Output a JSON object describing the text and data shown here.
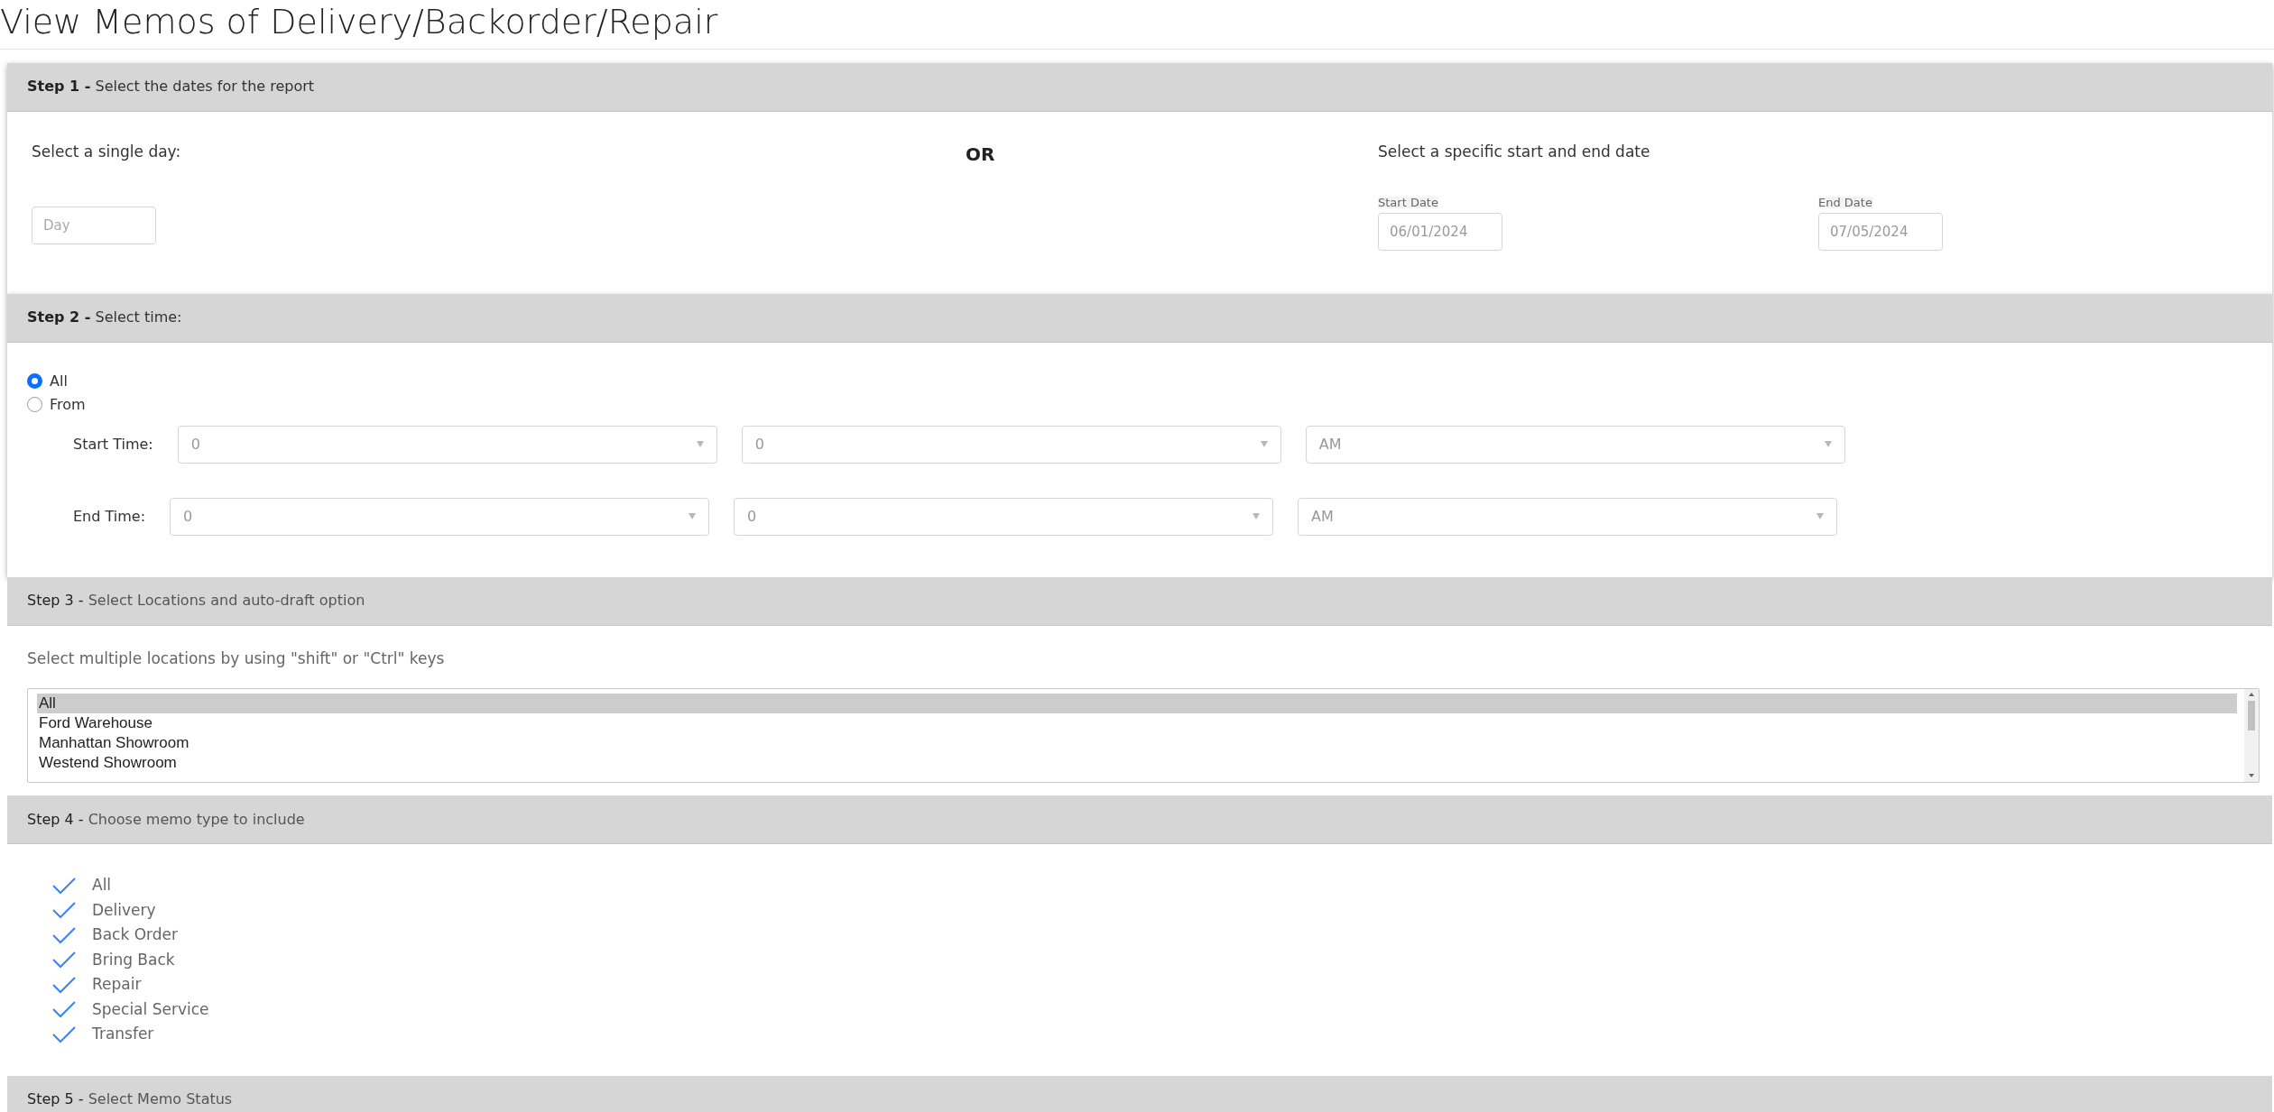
{
  "title": "View Memos of Delivery/Backorder/Repair",
  "steps": [
    {
      "kind": "dates",
      "label": "Step 1 -",
      "text": "Select the dates for the report",
      "active": true,
      "single_day": {
        "label": "Select a single day:",
        "placeholder": "Day"
      },
      "separator": "OR",
      "range": {
        "label": "Select a specific start and end date",
        "start_date": {
          "label": "Start Date",
          "value": "06/01/2024"
        },
        "end_date": {
          "label": "End Date",
          "value": "07/05/2024"
        }
      }
    },
    {
      "kind": "time",
      "label": "Step 2 -",
      "text": "Select time:",
      "active": true,
      "options": [
        {
          "label": "All",
          "selected": true
        },
        {
          "label": "From",
          "selected": false
        }
      ],
      "times": [
        {
          "label": "Start Time:",
          "hour": "0",
          "minute": "0",
          "period": "AM"
        },
        {
          "label": "End Time:",
          "hour": "0",
          "minute": "0",
          "period": "AM"
        }
      ]
    },
    {
      "kind": "locations",
      "label": "Step 3 -",
      "text": "Select Locations and auto-draft option",
      "active": false,
      "hint": "Select multiple locations by using \"shift\" or \"Ctrl\" keys",
      "locations": [
        {
          "label": "All",
          "selected": true
        },
        {
          "label": "Ford Warehouse",
          "selected": false
        },
        {
          "label": "Manhattan Showroom",
          "selected": false
        },
        {
          "label": "Westend Showroom",
          "selected": false
        }
      ]
    },
    {
      "kind": "memo_types",
      "label": "Step 4 -",
      "text": "Choose memo type to include",
      "active": false,
      "types": [
        {
          "label": "All",
          "checked": true
        },
        {
          "label": "Delivery",
          "checked": true
        },
        {
          "label": "Back Order",
          "checked": true
        },
        {
          "label": "Bring Back",
          "checked": true
        },
        {
          "label": "Repair",
          "checked": true
        },
        {
          "label": "Special Service",
          "checked": true
        },
        {
          "label": "Transfer",
          "checked": true
        }
      ]
    },
    {
      "kind": "status",
      "label": "Step 5 -",
      "text": "Select Memo Status",
      "active": false
    }
  ]
}
